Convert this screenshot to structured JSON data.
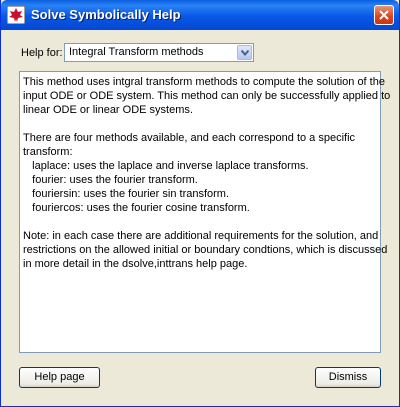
{
  "window": {
    "title": "Solve Symbolically Help",
    "icon": "maple-leaf-icon",
    "close_icon": "close-icon"
  },
  "help_for": {
    "label": "Help for:",
    "selected": "Integral Transform methods"
  },
  "content": {
    "lines": [
      "This method uses intgral transform methods to compute the solution of the",
      "input ODE or ODE system. This method can only be successfully applied to",
      "linear ODE or linear ODE systems.",
      "",
      "There are four methods available, and each correspond to a specific",
      "transform:",
      "   laplace: uses the laplace and inverse laplace transforms.",
      "   fourier: uses the fourier transform.",
      "   fouriersin: uses the fourier sin transform.",
      "   fouriercos: uses the fourier cosine transform.",
      "",
      "Note: in each case there are additional requirements for the solution, and",
      "restrictions on the allowed initial or boundary condtions, which is discussed",
      "in more detail in the dsolve,inttrans help page."
    ]
  },
  "buttons": {
    "help_page": "Help page",
    "dismiss": "Dismiss"
  },
  "colors": {
    "titlebar": "#0857e6",
    "window_bg": "#ece9d8",
    "close_button": "#d8431f"
  }
}
